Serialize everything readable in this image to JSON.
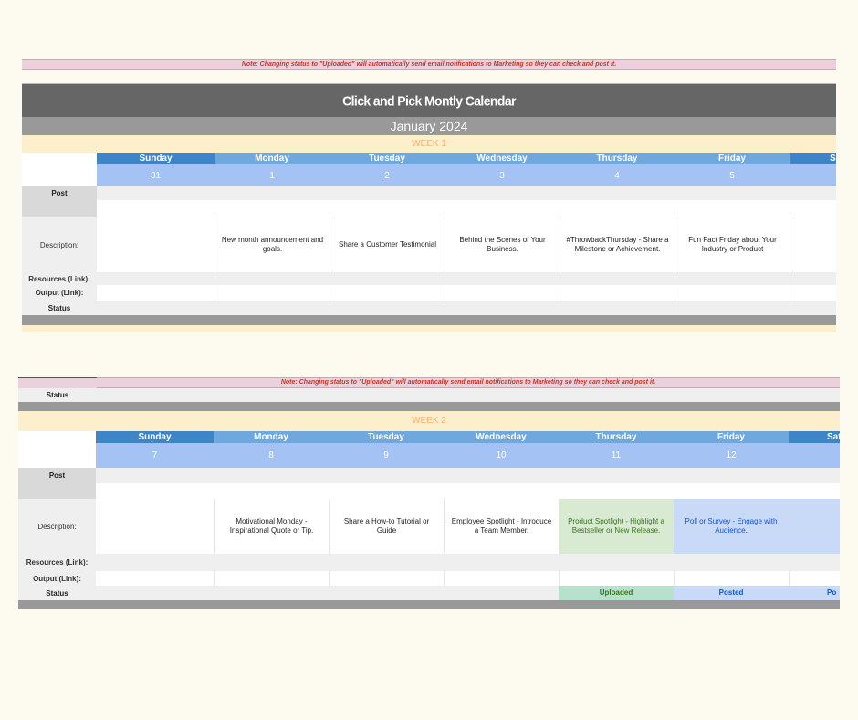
{
  "note": "Note: Changing status to \"Uploaded\" will automatically send email notifications to Marketing so they can check and post it.",
  "calendar_title": "Click and Pick Montly Calendar",
  "month": "January 2024",
  "labels": {
    "post": "Post",
    "description": "Description:",
    "resources": "Resources (Link):",
    "output": "Output (Link):",
    "status": "Status"
  },
  "week1": {
    "label": "WEEK 1",
    "days": [
      {
        "name": "Sunday",
        "num": "31",
        "desc": ""
      },
      {
        "name": "Monday",
        "num": "1",
        "desc": "New month announcement and goals."
      },
      {
        "name": "Tuesday",
        "num": "2",
        "desc": "Share a Customer Testimonial"
      },
      {
        "name": "Wednesday",
        "num": "3",
        "desc": "Behind the Scenes of Your Business."
      },
      {
        "name": "Thursday",
        "num": "4",
        "desc": "#ThrowbackThursday - Share a Milestone or Achievement."
      },
      {
        "name": "Friday",
        "num": "5",
        "desc": "Fun Fact Friday about Your Industry or Product"
      },
      {
        "name": "Sa",
        "num": "",
        "desc": ""
      }
    ]
  },
  "week2": {
    "label": "WEEK 2",
    "days": [
      {
        "name": "Sunday",
        "num": "7",
        "desc": "",
        "status": ""
      },
      {
        "name": "Monday",
        "num": "8",
        "desc": "Motivational Monday - Inspirational Quote or Tip.",
        "status": ""
      },
      {
        "name": "Tuesday",
        "num": "9",
        "desc": "Share a How-to Tutorial or Guide",
        "status": ""
      },
      {
        "name": "Wednesday",
        "num": "10",
        "desc": "Employee Spotlight - Introduce a Team Member.",
        "status": ""
      },
      {
        "name": "Thursday",
        "num": "11",
        "desc": "Product Spotlight - Highlight a Bestseller or New Release.",
        "status": "Uploaded"
      },
      {
        "name": "Friday",
        "num": "12",
        "desc": "Poll or Survey - Engage with Audience.",
        "status": "Posted"
      },
      {
        "name": "Sat",
        "num": "",
        "desc": "",
        "status": "Po"
      }
    ]
  },
  "colors": {
    "uploaded_bg": "#b7e1cd",
    "uploaded_cell": "#d9ead3",
    "uploaded_text": "#38761d",
    "posted_bg": "#c9daf8",
    "posted_text": "#1155cc"
  }
}
